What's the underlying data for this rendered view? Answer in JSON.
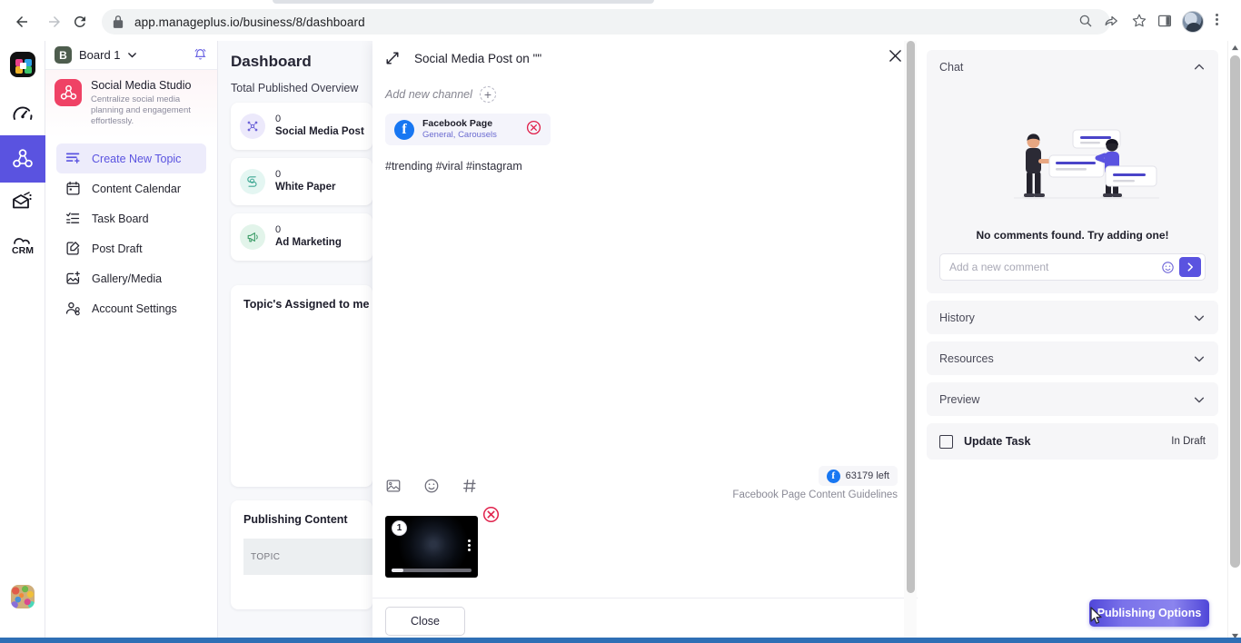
{
  "browser": {
    "url": "app.manageplus.io/business/8/dashboard",
    "back_icon": "back-arrow-icon",
    "forward_icon": "forward-arrow-icon",
    "reload_icon": "reload-icon",
    "lock_icon": "lock-icon",
    "zoom_icon": "search-zoom-icon",
    "share_icon": "share-icon",
    "star_icon": "bookmark-star-icon",
    "sidepanel_icon": "side-panel-icon",
    "menu_icon": "three-dot-menu-icon"
  },
  "rail": {
    "items": [
      {
        "name": "apps-logo"
      },
      {
        "name": "dashboard-gauge"
      },
      {
        "name": "social-media-studio"
      },
      {
        "name": "campaign-mail"
      },
      {
        "name": "crm"
      }
    ]
  },
  "nav": {
    "board_badge": "B",
    "board_name": "Board 1",
    "studio_title": "Social Media Studio",
    "studio_subtitle": "Centralize social media planning and engagement effortlessly.",
    "items": [
      {
        "label": "Create New Topic",
        "icon": "create-topic-icon",
        "active": true
      },
      {
        "label": "Content Calendar",
        "icon": "calendar-icon",
        "active": false
      },
      {
        "label": "Task Board",
        "icon": "task-list-icon",
        "active": false
      },
      {
        "label": "Post Draft",
        "icon": "draft-edit-icon",
        "active": false
      },
      {
        "label": "Gallery/Media",
        "icon": "gallery-add-icon",
        "active": false
      },
      {
        "label": "Account Settings",
        "icon": "account-settings-icon",
        "active": false
      }
    ]
  },
  "dashboard": {
    "title": "Dashboard",
    "subtitle": "Total Published Overview",
    "stats": [
      {
        "count": "0",
        "label": "Social Media Post",
        "icon": "network-nodes-icon",
        "bg": "#ece9fb",
        "fg": "#6c63d8"
      },
      {
        "count": "0",
        "label": "White Paper",
        "icon": "document-swirl-icon",
        "bg": "#e4f6f2",
        "fg": "#3fa894"
      },
      {
        "count": "0",
        "label": "Ad Marketing",
        "icon": "megaphone-icon",
        "bg": "#e2f4ea",
        "fg": "#3f9e6a"
      }
    ],
    "assigned_title": "Topic's Assigned to me",
    "publishing_title": "Publishing Content",
    "topic_column": "TOPIC"
  },
  "modal": {
    "title": "Social Media Post on \"\"",
    "expand_icon": "expand-diagonal-icon",
    "close_icon": "close-x-icon",
    "add_channel_label": "Add new channel",
    "add_channel_plus": "+",
    "channel": {
      "name": "Facebook Page",
      "subtitle": "General, Carousels",
      "logo": "facebook-icon",
      "logo_letter": "f",
      "remove_icon": "remove-circle-icon"
    },
    "composer_text": "#trending #viral #instagram",
    "tools": [
      {
        "name": "image-upload-icon"
      },
      {
        "name": "emoji-icon"
      },
      {
        "name": "hashtag-icon"
      }
    ],
    "char_count": "63179 left",
    "guidelines": "Facebook Page Content Guidelines",
    "attachment": {
      "index_badge": "1",
      "kebab_icon": "more-vertical-icon",
      "remove_icon": "remove-circle-icon"
    },
    "close_button": "Close"
  },
  "right_panel": {
    "chat": {
      "title": "Chat",
      "collapse_icon": "chevron-up-icon",
      "empty_message": "No comments found. Try adding one!",
      "comment_placeholder": "Add a new comment",
      "comment_value": "",
      "emoji_icon": "emoji-icon",
      "send_icon": "send-arrow-icon"
    },
    "sections": [
      {
        "title": "History",
        "icon": "chevron-down-icon"
      },
      {
        "title": "Resources",
        "icon": "chevron-down-icon"
      },
      {
        "title": "Preview",
        "icon": "chevron-down-icon"
      }
    ],
    "task": {
      "label": "Update Task",
      "status": "In Draft",
      "checked": false
    }
  },
  "footer": {
    "publishing_button": "Publishing Options"
  },
  "colors": {
    "accent": "#5a53e0",
    "brand_pink": "#ef4265",
    "facebook_blue": "#1877f2",
    "danger": "#e0214b"
  }
}
